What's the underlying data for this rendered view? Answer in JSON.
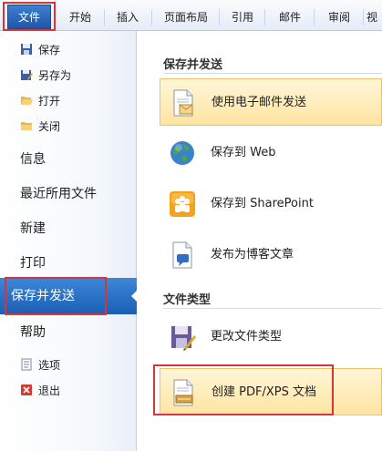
{
  "ribbon": {
    "tabs": [
      "文件",
      "开始",
      "插入",
      "页面布局",
      "引用",
      "邮件",
      "审阅",
      "视"
    ]
  },
  "nav": {
    "small_top": [
      "保存",
      "另存为",
      "打开",
      "关闭"
    ],
    "big": [
      "信息",
      "最近所用文件",
      "新建",
      "打印"
    ],
    "selected": "保存并发送",
    "help": "帮助",
    "small_bottom": [
      "选项",
      "退出"
    ]
  },
  "pane": {
    "section1_title": "保存并发送",
    "send_email": "使用电子邮件发送",
    "save_web": "保存到 Web",
    "save_sharepoint": "保存到 SharePoint",
    "publish_blog": "发布为博客文章",
    "section2_title": "文件类型",
    "change_type": "更改文件类型",
    "create_pdf": "创建 PDF/XPS 文档"
  },
  "colors": {
    "accent_blue": "#1f5fb5",
    "highlight_red": "#d8343a",
    "active_option": "#ffe4a0"
  }
}
